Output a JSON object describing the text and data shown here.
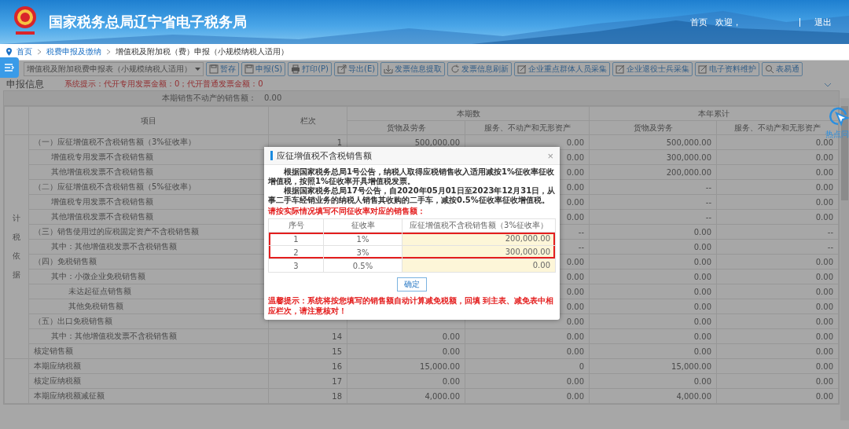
{
  "header": {
    "title": "国家税务总局辽宁省电子税务局",
    "home": "首页",
    "welcome": "欢迎，",
    "logout": "退出"
  },
  "breadcrumb": [
    {
      "label": "首页",
      "link": true
    },
    {
      "label": "税费申报及缴纳",
      "link": true
    },
    {
      "label": "增值税及附加税（费）申报（小规模纳税人适用）",
      "link": false
    }
  ],
  "toolbar": {
    "report_select": "增值税及附加税费申报表（小规模纳税人适用）",
    "buttons": [
      {
        "label": "暂存",
        "kind": "save"
      },
      {
        "label": "申报(S)",
        "kind": "save"
      },
      {
        "label": "打印(P)",
        "kind": "print"
      },
      {
        "label": "导出(E)",
        "kind": "export"
      },
      {
        "label": "发票信息提取",
        "kind": "tray"
      },
      {
        "label": "发票信息刷新",
        "kind": "refresh"
      },
      {
        "label": "企业重点群体人员采集",
        "kind": "edit"
      },
      {
        "label": "企业退役士兵采集",
        "kind": "edit"
      },
      {
        "label": "电子资料维护",
        "kind": "edit"
      },
      {
        "label": "表易通",
        "kind": "search"
      }
    ]
  },
  "section_title": "申报信息",
  "notice": "系统提示：代开专用发票金额：0；代开普通发票金额：0",
  "real_estate": {
    "label": "本期销售不动产的销售额：",
    "value": "0.00"
  },
  "table": {
    "columns": {
      "item": "项目",
      "line": "栏次",
      "current": "本期数",
      "year": "本年累计",
      "goods": "货物及劳务",
      "services": "服务、不动产和无形资产",
      "goods_2": "货物及劳务",
      "services_2": "服务、不动产和无形资产"
    },
    "groups": [
      {
        "label": "计税依据",
        "rows": [
          {
            "label": "（一）应征增值税不含税销售额（3%征收率）",
            "cells": [
              "1",
              "500,000.00",
              "0.00",
              "500,000.00",
              "0.00"
            ],
            "children": [
              {
                "label": "增值税专用发票不含税销售额",
                "cells": [
                  null,
                  null,
                  "0.00",
                  "300,000.00",
                  "0.00"
                ]
              },
              {
                "label": "其他增值税发票不含税销售额",
                "cells": [
                  null,
                  null,
                  "0.00",
                  "200,000.00",
                  "0.00"
                ]
              }
            ]
          },
          {
            "label": "（二）应征增值税不含税销售额（5%征收率）",
            "cells": [
              null,
              null,
              "0.00",
              "--",
              "0.00"
            ],
            "children": [
              {
                "label": "增值税专用发票不含税销售额",
                "cells": [
                  null,
                  null,
                  "0.00",
                  "--",
                  "0.00"
                ]
              },
              {
                "label": "其他增值税发票不含税销售额",
                "cells": [
                  null,
                  null,
                  "0.00",
                  "--",
                  "0.00"
                ]
              }
            ]
          },
          {
            "label": "（三）销售使用过的应税固定资产不含税销售额",
            "cells": [
              null,
              null,
              "--",
              "0.00",
              "--"
            ],
            "children": [
              {
                "label": "其中：其他增值税发票不含税销售额",
                "cells": [
                  null,
                  null,
                  "--",
                  "0.00",
                  "--"
                ]
              }
            ]
          },
          {
            "label": "（四）免税销售额",
            "cells": [
              null,
              null,
              "0.00",
              "0.00",
              "0.00"
            ],
            "children": [
              {
                "label": "其中：小微企业免税销售额",
                "cells": [
                  null,
                  null,
                  "0.00",
                  "0.00",
                  "0.00"
                ],
                "children": [
                  {
                    "label": "未达起征点销售额",
                    "cells": [
                      null,
                      null,
                      "0.00",
                      "0.00",
                      "0.00"
                    ]
                  },
                  {
                    "label": "其他免税销售额",
                    "cells": [
                      null,
                      null,
                      "0.00",
                      "0.00",
                      "0.00"
                    ]
                  }
                ]
              }
            ]
          },
          {
            "label": "（五）出口免税销售额",
            "cells": [
              null,
              null,
              "0.00",
              "0.00",
              "0.00"
            ],
            "children": [
              {
                "label": "其中：其他增值税发票不含税销售额",
                "cells": [
                  "14",
                  "0.00",
                  "0.00",
                  "0.00",
                  "0.00"
                ]
              }
            ]
          },
          {
            "label": "核定销售额",
            "cells": [
              "15",
              "0.00",
              "0.00",
              "0.00",
              "0.00"
            ]
          }
        ]
      },
      {
        "rows": [
          {
            "label": "本期应纳税额",
            "cells": [
              "16",
              "15,000.00",
              "0",
              "15,000.00",
              "0.00"
            ]
          },
          {
            "label": "核定应纳税额",
            "cells": [
              "17",
              "0.00",
              "0.00",
              "0.00",
              "0.00"
            ]
          },
          {
            "label": "本期应纳税额减征额",
            "cells": [
              "18",
              "4,000.00",
              "0.00",
              "4,000.00",
              "0.00"
            ]
          }
        ]
      }
    ]
  },
  "modal": {
    "title": "应征增值税不含税销售额",
    "close": "×",
    "paragraphs": [
      "根据国家税务总局1号公告，纳税人取得应税销售收入适用减按1%征收率征收增值税，按照1%征收率开具增值税发票。",
      "根据国家税务总局17号公告，自2020年05月01日至2023年12月31日，从事二手车经销业务的纳税人销售其收购的二手车，减按0.5%征收率征收增值税。"
    ],
    "instruction": "请按实际情况填写不同征收率对应的销售额：",
    "columns": [
      "序号",
      "征收率",
      "应征增值税不含税销售额（3%征收率）"
    ],
    "rows": [
      {
        "no": "1",
        "rate": "1%",
        "amount": "200,000.00",
        "highlighted": true
      },
      {
        "no": "2",
        "rate": "3%",
        "amount": "300,000.00",
        "highlighted": true
      },
      {
        "no": "3",
        "rate": "0.5%",
        "amount": "0.00",
        "highlighted": false
      }
    ],
    "confirm": "确定",
    "tip": "温馨提示：系统将按您填写的销售额自动计算减免税额，回填 到主表、减免表中相应栏次，请注意核对！"
  },
  "side_tool": {
    "label": "热点问"
  }
}
